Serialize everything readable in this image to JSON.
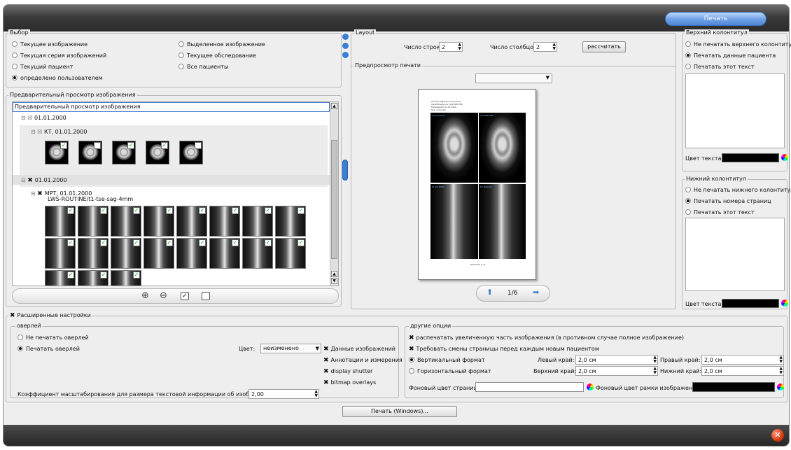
{
  "toolbar": {
    "print_label": "Печать"
  },
  "selection": {
    "title": "Выбор",
    "options": [
      {
        "label": "Текущее изображение",
        "selected": false
      },
      {
        "label": "Текущая серия изображений",
        "selected": false
      },
      {
        "label": "Текущий пациент",
        "selected": false
      },
      {
        "label": "определено пользователем",
        "selected": true
      },
      {
        "label": "Выделенное изображение",
        "selected": false
      },
      {
        "label": "Текущее обследование",
        "selected": false
      },
      {
        "label": "Все пациенты",
        "selected": false
      }
    ]
  },
  "image_preview": {
    "title": "Предварительный просмотр изображения",
    "tree_header": "Предварительный просмотр изображения",
    "nodes": {
      "date1": "01.01.2000",
      "ct_study": "КТ, 01.01.2000",
      "date2": "01.01.2000",
      "mrt_study": "МРТ, 01.01.2000",
      "mrt_series": "LWS-ROUTINE/t1-tse-sag-4mm"
    }
  },
  "layout": {
    "title": "Layout",
    "rows_label": "Число строк:",
    "rows_value": "2",
    "cols_label": "Число столбцов:",
    "cols_value": "2",
    "calculate_button": "рассчитать",
    "preview_title": "Предпросмотр печати",
    "page_indicator": "1/6",
    "page_header_lines": [
      "Ahmed Koganfe Anonymous",
      "Identifikasjonsnr 0123456789",
      "Fødselsdato 01.01.2000",
      "Sex: unknown"
    ],
    "tile_labels": [
      "Anonymized",
      "0123456789",
      "01.01.2000",
      "Dr. Nobody",
      "BIGVISION"
    ],
    "footer": "Hjemside 1 / 6"
  },
  "header_section": {
    "title": "Верхний колонтитул",
    "options": [
      {
        "label": "Не печатать верхнего колонтитула",
        "selected": false
      },
      {
        "label": "Печатать данные пациента",
        "selected": true
      },
      {
        "label": "Печатать этот текст",
        "selected": false
      }
    ],
    "text_color_label": "Цвет текста:"
  },
  "footer_section": {
    "title": "Нижний колонтитул",
    "options": [
      {
        "label": "Не печатать нижнего колонтитула",
        "selected": false
      },
      {
        "label": "Печатать номера страниц",
        "selected": true
      },
      {
        "label": "Печатать этот текст",
        "selected": false
      }
    ],
    "text_color_label": "Цвет текста:"
  },
  "advanced": {
    "label": "Расширенные настройки",
    "overlay": {
      "title": "оверлей",
      "options": [
        {
          "label": "Не печатать оверлей",
          "selected": false
        },
        {
          "label": "Печатать оверлей",
          "selected": true
        }
      ],
      "color_label": "Цвет:",
      "color_value": "неизменено",
      "checks": [
        "Данные изображений",
        "Аннотации и измерения",
        "display shutter",
        "bitmap overlays"
      ],
      "scale_label": "Коэффициент масштабирования для размера текстовой информации об изображении:",
      "scale_value": "2,00"
    },
    "other": {
      "title": "другие опции",
      "check1": "распечатать увеличенную часть изображения (в противном случае полное изображение)",
      "check2": "Требовать смены страницы перед каждым новым пациентом",
      "portrait": "Вертикальный формат",
      "landscape": "Горизонтальный формат",
      "left_margin_label": "Левый край:",
      "left_margin": "2,0 см",
      "right_margin_label": "Правый край:",
      "right_margin": "2,0 см",
      "top_margin_label": "Верхний край:",
      "top_margin": "2,0 см",
      "bottom_margin_label": "Нижний край:",
      "bottom_margin": "2,0 см",
      "bg_color_label": "Фоновый цвет страницы:",
      "frame_color_label": "Фоновый цвет рамки изображения:"
    }
  },
  "windows_print_button": "Печать (Windows)...",
  "colors": {
    "accent": "#5b8fdc",
    "titlebar": "#333333",
    "close": "#d43a12"
  }
}
